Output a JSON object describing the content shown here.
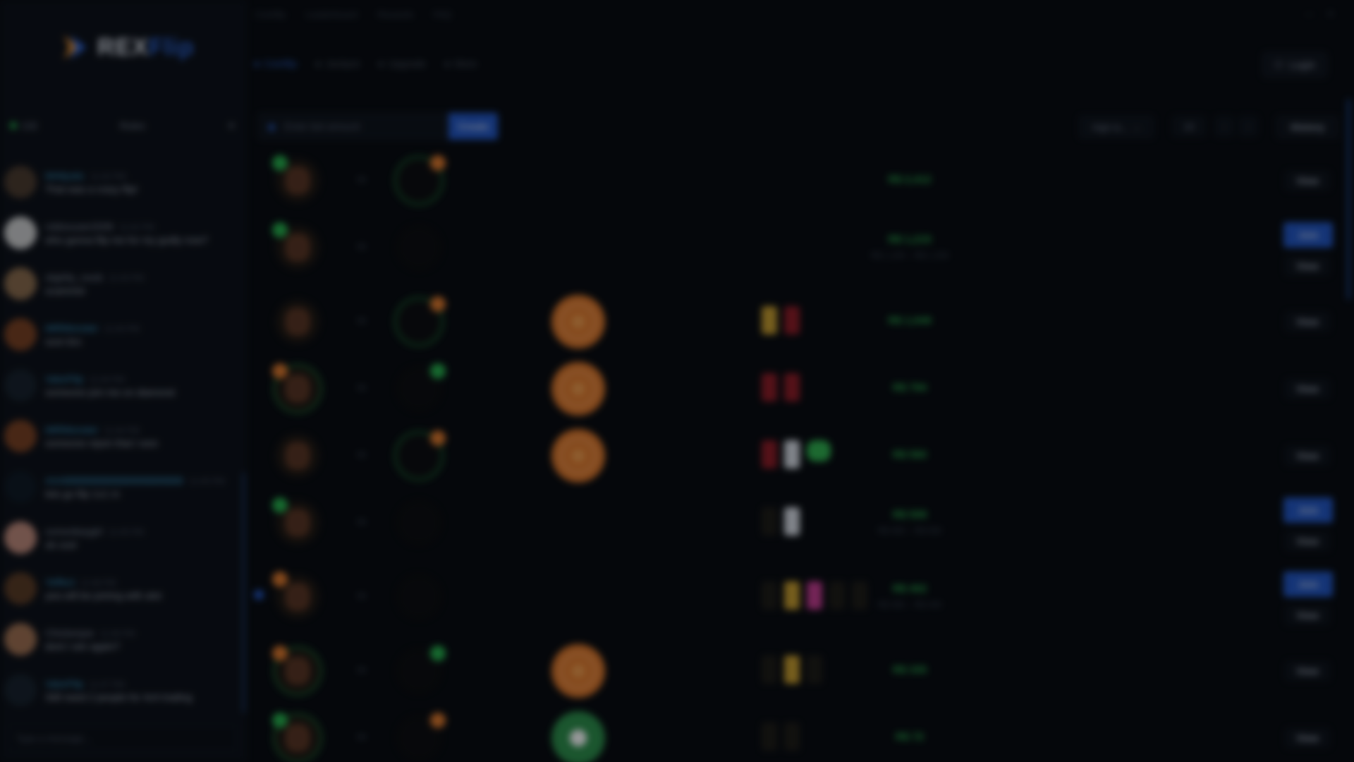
{
  "brand": {
    "name_a": "REX",
    "name_b": "Flip"
  },
  "topnav": {
    "items": [
      "Coinflip",
      "Leaderboard",
      "Rewards",
      "FAQ"
    ],
    "window": [
      "—",
      "✕"
    ]
  },
  "subnav": {
    "tabs": [
      "Coinflip",
      "Jackpot",
      "Upgrade",
      "More"
    ]
  },
  "login_label": "Login",
  "sidebar": {
    "online": "132",
    "rules": "Rules",
    "input_placeholder": "Type a message..."
  },
  "chat": [
    {
      "user": "MrMystic",
      "time": "11:42 PM",
      "text": "That was a crazy flip!",
      "vip": true
    },
    {
      "user": "robloxuser2008",
      "time": "11:42 PM",
      "text": "who gonna flip me for my godly now?",
      "vip": false
    },
    {
      "user": "slightly_noob",
      "time": "11:43 PM",
      "text": "scammer",
      "vip": false
    },
    {
      "user": "iMRMonster",
      "time": "11:43 PM",
      "text": "sure bro",
      "vip": true
    },
    {
      "user": "ValorFlip",
      "time": "11:44 PM",
      "text": "someone join me on diamond",
      "vip": true
    },
    {
      "user": "iMRMonster",
      "time": "11:44 PM",
      "text": "someone rejoin that I won",
      "vip": true
    },
    {
      "user": "AAABBBBBBBBBBBBBBBBBB",
      "time": "11:45 PM",
      "text": "lets go flip 1v1 rn",
      "vip": true
    },
    {
      "user": "xxmonkeygirl",
      "time": "11:45 PM",
      "text": "ok cool",
      "vip": false
    },
    {
      "user": "Yeffect",
      "time": "11:46 PM",
      "text": "yea will be joining with alot",
      "vip": true
    },
    {
      "user": "Chickenjoe",
      "time": "11:46 PM",
      "text": "dont I win again?",
      "vip": false
    },
    {
      "user": "ValorFlip",
      "time": "11:47 PM",
      "text": "Still need 2 people for 4v4 trading",
      "vip": true
    }
  ],
  "controls": {
    "amount_placeholder": "Enter bet amount",
    "create_label": "Create",
    "sort_label": "High to...",
    "count_label": "10",
    "prev": "‹",
    "next": "›",
    "history_label": "History"
  },
  "games": [
    {
      "value": "R$ 2,412",
      "range": "",
      "join": false
    },
    {
      "value": "R$ 1,215",
      "range": "R$ 1,100 – R$ 1,330",
      "join": true
    },
    {
      "value": "R$ 1,049",
      "range": "",
      "join": false
    },
    {
      "value": "R$ 794",
      "range": "",
      "join": false
    },
    {
      "value": "R$ 560",
      "range": "",
      "join": false
    },
    {
      "value": "R$ 508",
      "range": "R$ 460 – R$ 560",
      "join": true
    },
    {
      "value": "R$ 402",
      "range": "R$ 365 – R$ 440",
      "join": true
    },
    {
      "value": "R$ 335",
      "range": "",
      "join": false
    },
    {
      "value": "R$ 72",
      "range": "",
      "join": false
    }
  ],
  "labels": {
    "vs": "vs",
    "view": "View",
    "join": "Join"
  }
}
